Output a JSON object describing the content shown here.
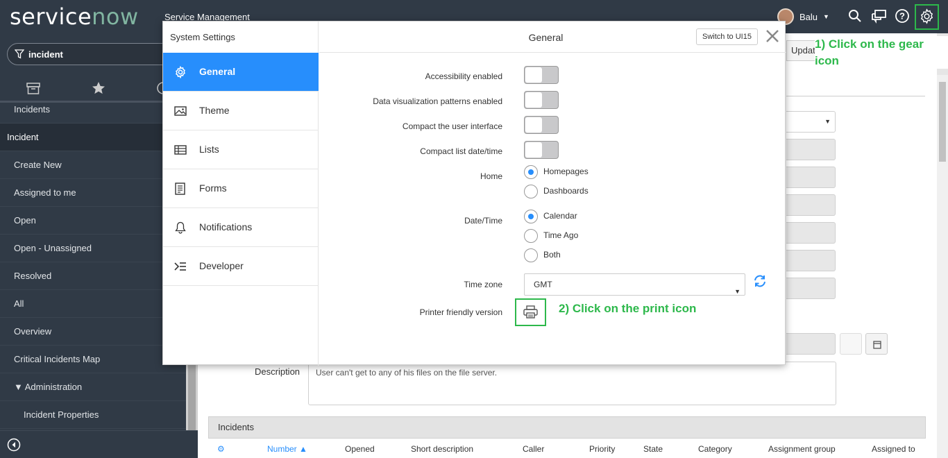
{
  "header": {
    "logo_service": "service",
    "logo_now": "now",
    "app_title": "Service Management",
    "user_name": "Balu",
    "icons": [
      "search-icon",
      "chat-icon",
      "help-icon",
      "gear-icon"
    ]
  },
  "nav": {
    "filter_value": "incident",
    "items": [
      {
        "label": "Incidents",
        "type": "item"
      },
      {
        "label": "Incident",
        "type": "section"
      },
      {
        "label": "Create New",
        "type": "item"
      },
      {
        "label": "Assigned to me",
        "type": "item"
      },
      {
        "label": "Open",
        "type": "item"
      },
      {
        "label": "Open - Unassigned",
        "type": "item"
      },
      {
        "label": "Resolved",
        "type": "item"
      },
      {
        "label": "All",
        "type": "item"
      },
      {
        "label": "Overview",
        "type": "item"
      },
      {
        "label": "Critical Incidents Map",
        "type": "item"
      },
      {
        "label": "▼ Administration",
        "type": "item"
      },
      {
        "label": "Incident Properties",
        "type": "subitem"
      }
    ]
  },
  "background": {
    "update_label": "Update",
    "description_label": "Description",
    "description_value": "User can't get to any of his files on the file server.",
    "incidents_bar_label": "Incidents",
    "list_columns": [
      "Number ▲",
      "Opened",
      "Short description",
      "Caller",
      "Priority",
      "State",
      "Category",
      "Assignment group",
      "Assigned to"
    ]
  },
  "annotations": {
    "step1": "1) Click on the gear icon",
    "step2": "2) Click on the print icon",
    "color": "#2db84b"
  },
  "modal": {
    "side_title": "System Settings",
    "menu": [
      {
        "label": "General",
        "icon": "gear-icon",
        "active": true
      },
      {
        "label": "Theme",
        "icon": "image-icon",
        "active": false
      },
      {
        "label": "Lists",
        "icon": "list-icon",
        "active": false
      },
      {
        "label": "Forms",
        "icon": "form-icon",
        "active": false
      },
      {
        "label": "Notifications",
        "icon": "bell-icon",
        "active": false
      },
      {
        "label": "Developer",
        "icon": "code-icon",
        "active": false
      }
    ],
    "title": "General",
    "switch_label": "Switch to UI15",
    "settings": {
      "accessibility": "Accessibility enabled",
      "data_vis": "Data visualization patterns enabled",
      "compact_ui": "Compact the user interface",
      "compact_list": "Compact list date/time",
      "home_label": "Home",
      "home_options": [
        "Homepages",
        "Dashboards"
      ],
      "home_selected": "Homepages",
      "datetime_label": "Date/Time",
      "datetime_options": [
        "Calendar",
        "Time Ago",
        "Both"
      ],
      "datetime_selected": "Calendar",
      "timezone_label": "Time zone",
      "timezone_value": "GMT",
      "printer_label": "Printer friendly version"
    },
    "accent_color": "#278efc"
  }
}
